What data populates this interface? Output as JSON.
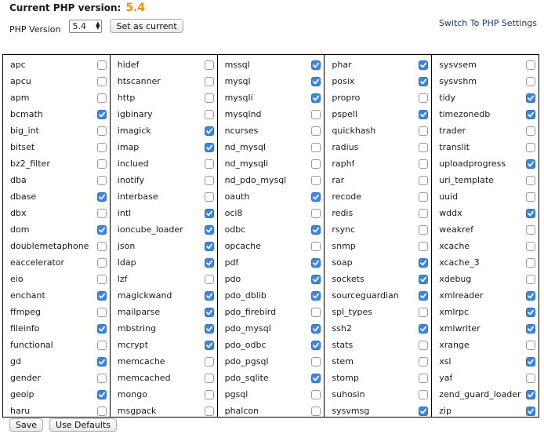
{
  "header": {
    "title_label": "Current PHP version:",
    "current_version": "5.4",
    "version_label": "PHP Version",
    "version_select_value": "5.4",
    "set_current_label": "Set as current",
    "switch_link_label": "Switch To PHP Settings"
  },
  "columns": [
    [
      {
        "name": "apc",
        "checked": false
      },
      {
        "name": "apcu",
        "checked": false
      },
      {
        "name": "apm",
        "checked": false
      },
      {
        "name": "bcmath",
        "checked": true
      },
      {
        "name": "big_int",
        "checked": false
      },
      {
        "name": "bitset",
        "checked": false
      },
      {
        "name": "bz2_filter",
        "checked": false
      },
      {
        "name": "dba",
        "checked": false
      },
      {
        "name": "dbase",
        "checked": true
      },
      {
        "name": "dbx",
        "checked": false
      },
      {
        "name": "dom",
        "checked": true
      },
      {
        "name": "doublemetaphone",
        "checked": false
      },
      {
        "name": "eaccelerator",
        "checked": false
      },
      {
        "name": "eio",
        "checked": false
      },
      {
        "name": "enchant",
        "checked": true
      },
      {
        "name": "ffmpeg",
        "checked": false
      },
      {
        "name": "fileinfo",
        "checked": true
      },
      {
        "name": "functional",
        "checked": false
      },
      {
        "name": "gd",
        "checked": true
      },
      {
        "name": "gender",
        "checked": false
      },
      {
        "name": "geoip",
        "checked": true
      },
      {
        "name": "haru",
        "checked": false
      }
    ],
    [
      {
        "name": "hidef",
        "checked": false
      },
      {
        "name": "htscanner",
        "checked": false
      },
      {
        "name": "http",
        "checked": false
      },
      {
        "name": "igbinary",
        "checked": false
      },
      {
        "name": "imagick",
        "checked": true
      },
      {
        "name": "imap",
        "checked": true
      },
      {
        "name": "inclued",
        "checked": false
      },
      {
        "name": "inotify",
        "checked": false
      },
      {
        "name": "interbase",
        "checked": false
      },
      {
        "name": "intl",
        "checked": true
      },
      {
        "name": "ioncube_loader",
        "checked": true
      },
      {
        "name": "json",
        "checked": true
      },
      {
        "name": "ldap",
        "checked": true
      },
      {
        "name": "lzf",
        "checked": false
      },
      {
        "name": "magickwand",
        "checked": true
      },
      {
        "name": "mailparse",
        "checked": true
      },
      {
        "name": "mbstring",
        "checked": true
      },
      {
        "name": "mcrypt",
        "checked": true
      },
      {
        "name": "memcache",
        "checked": false
      },
      {
        "name": "memcached",
        "checked": false
      },
      {
        "name": "mongo",
        "checked": false
      },
      {
        "name": "msgpack",
        "checked": false
      }
    ],
    [
      {
        "name": "mssql",
        "checked": true
      },
      {
        "name": "mysql",
        "checked": true
      },
      {
        "name": "mysqli",
        "checked": true
      },
      {
        "name": "mysqlnd",
        "checked": false
      },
      {
        "name": "ncurses",
        "checked": false
      },
      {
        "name": "nd_mysql",
        "checked": false
      },
      {
        "name": "nd_mysqli",
        "checked": false
      },
      {
        "name": "nd_pdo_mysql",
        "checked": false
      },
      {
        "name": "oauth",
        "checked": true
      },
      {
        "name": "oci8",
        "checked": false
      },
      {
        "name": "odbc",
        "checked": true
      },
      {
        "name": "opcache",
        "checked": false
      },
      {
        "name": "pdf",
        "checked": true
      },
      {
        "name": "pdo",
        "checked": true
      },
      {
        "name": "pdo_dblib",
        "checked": true
      },
      {
        "name": "pdo_firebird",
        "checked": false
      },
      {
        "name": "pdo_mysql",
        "checked": true
      },
      {
        "name": "pdo_odbc",
        "checked": true
      },
      {
        "name": "pdo_pgsql",
        "checked": false
      },
      {
        "name": "pdo_sqlite",
        "checked": true
      },
      {
        "name": "pgsql",
        "checked": false
      },
      {
        "name": "phalcon",
        "checked": false
      }
    ],
    [
      {
        "name": "phar",
        "checked": true
      },
      {
        "name": "posix",
        "checked": true
      },
      {
        "name": "propro",
        "checked": false
      },
      {
        "name": "pspell",
        "checked": true
      },
      {
        "name": "quickhash",
        "checked": false
      },
      {
        "name": "radius",
        "checked": false
      },
      {
        "name": "raphf",
        "checked": false
      },
      {
        "name": "rar",
        "checked": false
      },
      {
        "name": "recode",
        "checked": false
      },
      {
        "name": "redis",
        "checked": false
      },
      {
        "name": "rsync",
        "checked": false
      },
      {
        "name": "snmp",
        "checked": false
      },
      {
        "name": "soap",
        "checked": true
      },
      {
        "name": "sockets",
        "checked": true
      },
      {
        "name": "sourceguardian",
        "checked": true
      },
      {
        "name": "spl_types",
        "checked": false
      },
      {
        "name": "ssh2",
        "checked": true
      },
      {
        "name": "stats",
        "checked": false
      },
      {
        "name": "stem",
        "checked": false
      },
      {
        "name": "stomp",
        "checked": false
      },
      {
        "name": "suhosin",
        "checked": false
      },
      {
        "name": "sysvmsg",
        "checked": true
      }
    ],
    [
      {
        "name": "sysvsem",
        "checked": false
      },
      {
        "name": "sysvshm",
        "checked": false
      },
      {
        "name": "tidy",
        "checked": true
      },
      {
        "name": "timezonedb",
        "checked": true
      },
      {
        "name": "trader",
        "checked": false
      },
      {
        "name": "translit",
        "checked": false
      },
      {
        "name": "uploadprogress",
        "checked": true
      },
      {
        "name": "uri_template",
        "checked": false
      },
      {
        "name": "uuid",
        "checked": false
      },
      {
        "name": "wddx",
        "checked": true
      },
      {
        "name": "weakref",
        "checked": false
      },
      {
        "name": "xcache",
        "checked": false
      },
      {
        "name": "xcache_3",
        "checked": false
      },
      {
        "name": "xdebug",
        "checked": false
      },
      {
        "name": "xmlreader",
        "checked": true
      },
      {
        "name": "xmlrpc",
        "checked": true
      },
      {
        "name": "xmlwriter",
        "checked": true
      },
      {
        "name": "xrange",
        "checked": false
      },
      {
        "name": "xsl",
        "checked": true
      },
      {
        "name": "yaf",
        "checked": false
      },
      {
        "name": "zend_guard_loader",
        "checked": true
      },
      {
        "name": "zip",
        "checked": true
      }
    ]
  ],
  "footer": {
    "save_label": "Save",
    "defaults_label": "Use Defaults"
  },
  "colors": {
    "version_accent": "#f08a24",
    "checkbox_checked": "#3b86e5",
    "link": "#163a6e"
  }
}
